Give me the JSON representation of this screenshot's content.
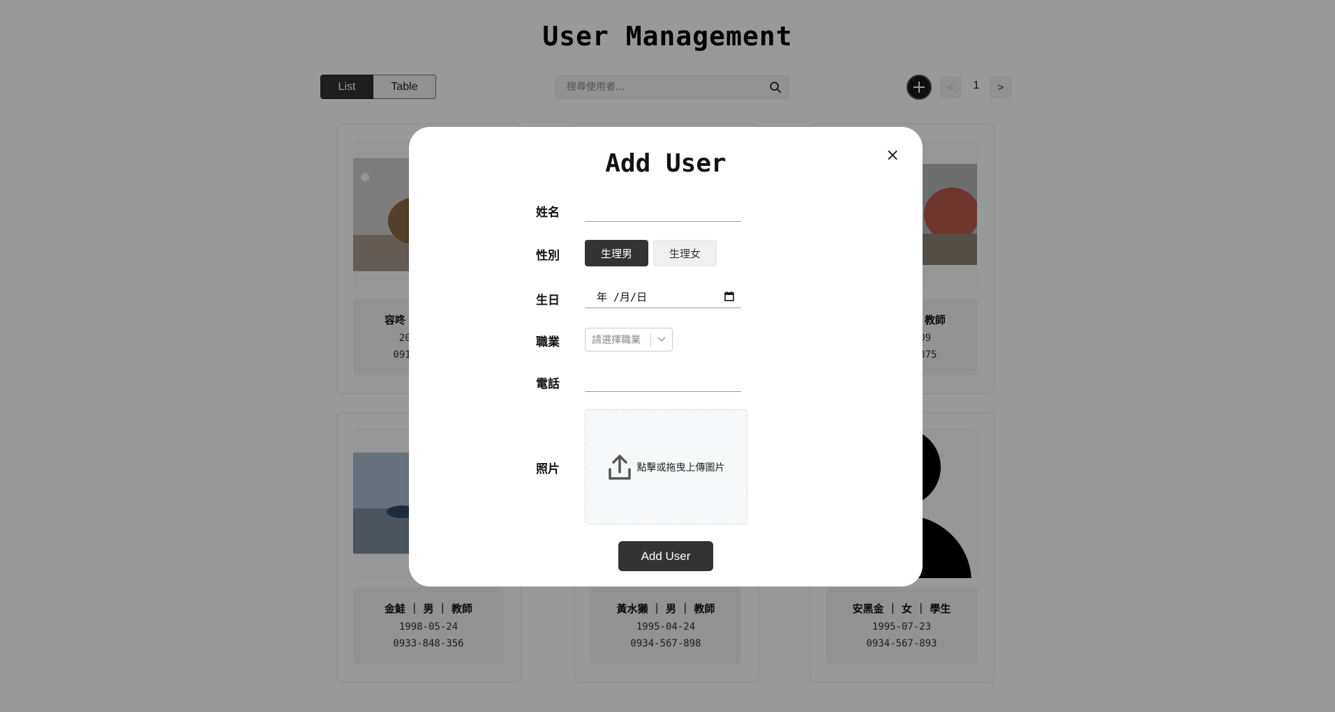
{
  "page": {
    "title": "User Management"
  },
  "toolbar": {
    "list_label": "List",
    "table_label": "Table",
    "search_placeholder": "搜尋使用者...",
    "prev_label": "<",
    "next_label": ">",
    "page_number": "1"
  },
  "cards": [
    {
      "name_line": "容咚 ｜ 男 ｜ 學生",
      "birthday": "2000-01-01",
      "phone": "0912-345-678"
    },
    {
      "name_line": "",
      "birthday": "",
      "phone": ""
    },
    {
      "name_line": "猴子 ｜ 男 ｜ 教師",
      "birthday": "1990-01-09",
      "phone": "0912-345-375"
    },
    {
      "name_line": "金鮭 ｜ 男 ｜ 教師",
      "birthday": "1998-05-24",
      "phone": "0933-848-356"
    },
    {
      "name_line": "黃水獺 ｜ 男 ｜ 教師",
      "birthday": "1995-04-24",
      "phone": "0934-567-898"
    },
    {
      "name_line": "安黑金 ｜ 女 ｜ 學生",
      "birthday": "1995-07-23",
      "phone": "0934-567-893"
    }
  ],
  "modal": {
    "title": "Add User",
    "close_symbol": "×",
    "labels": {
      "name": "姓名",
      "gender": "性別",
      "birthday": "生日",
      "job": "職業",
      "phone": "電話",
      "photo": "照片"
    },
    "gender_options": [
      "生理男",
      "生理女"
    ],
    "selected_gender": "生理男",
    "date_placeholder": "年 /月/日",
    "job_placeholder": "請選擇職業",
    "upload_text": "點擊或拖曳上傳圖片",
    "submit_label": "Add User"
  },
  "colors": {
    "primary": "#333333",
    "overlay": "rgba(0,0,0,0.4)",
    "upload_bg": "#f7f8fa"
  }
}
